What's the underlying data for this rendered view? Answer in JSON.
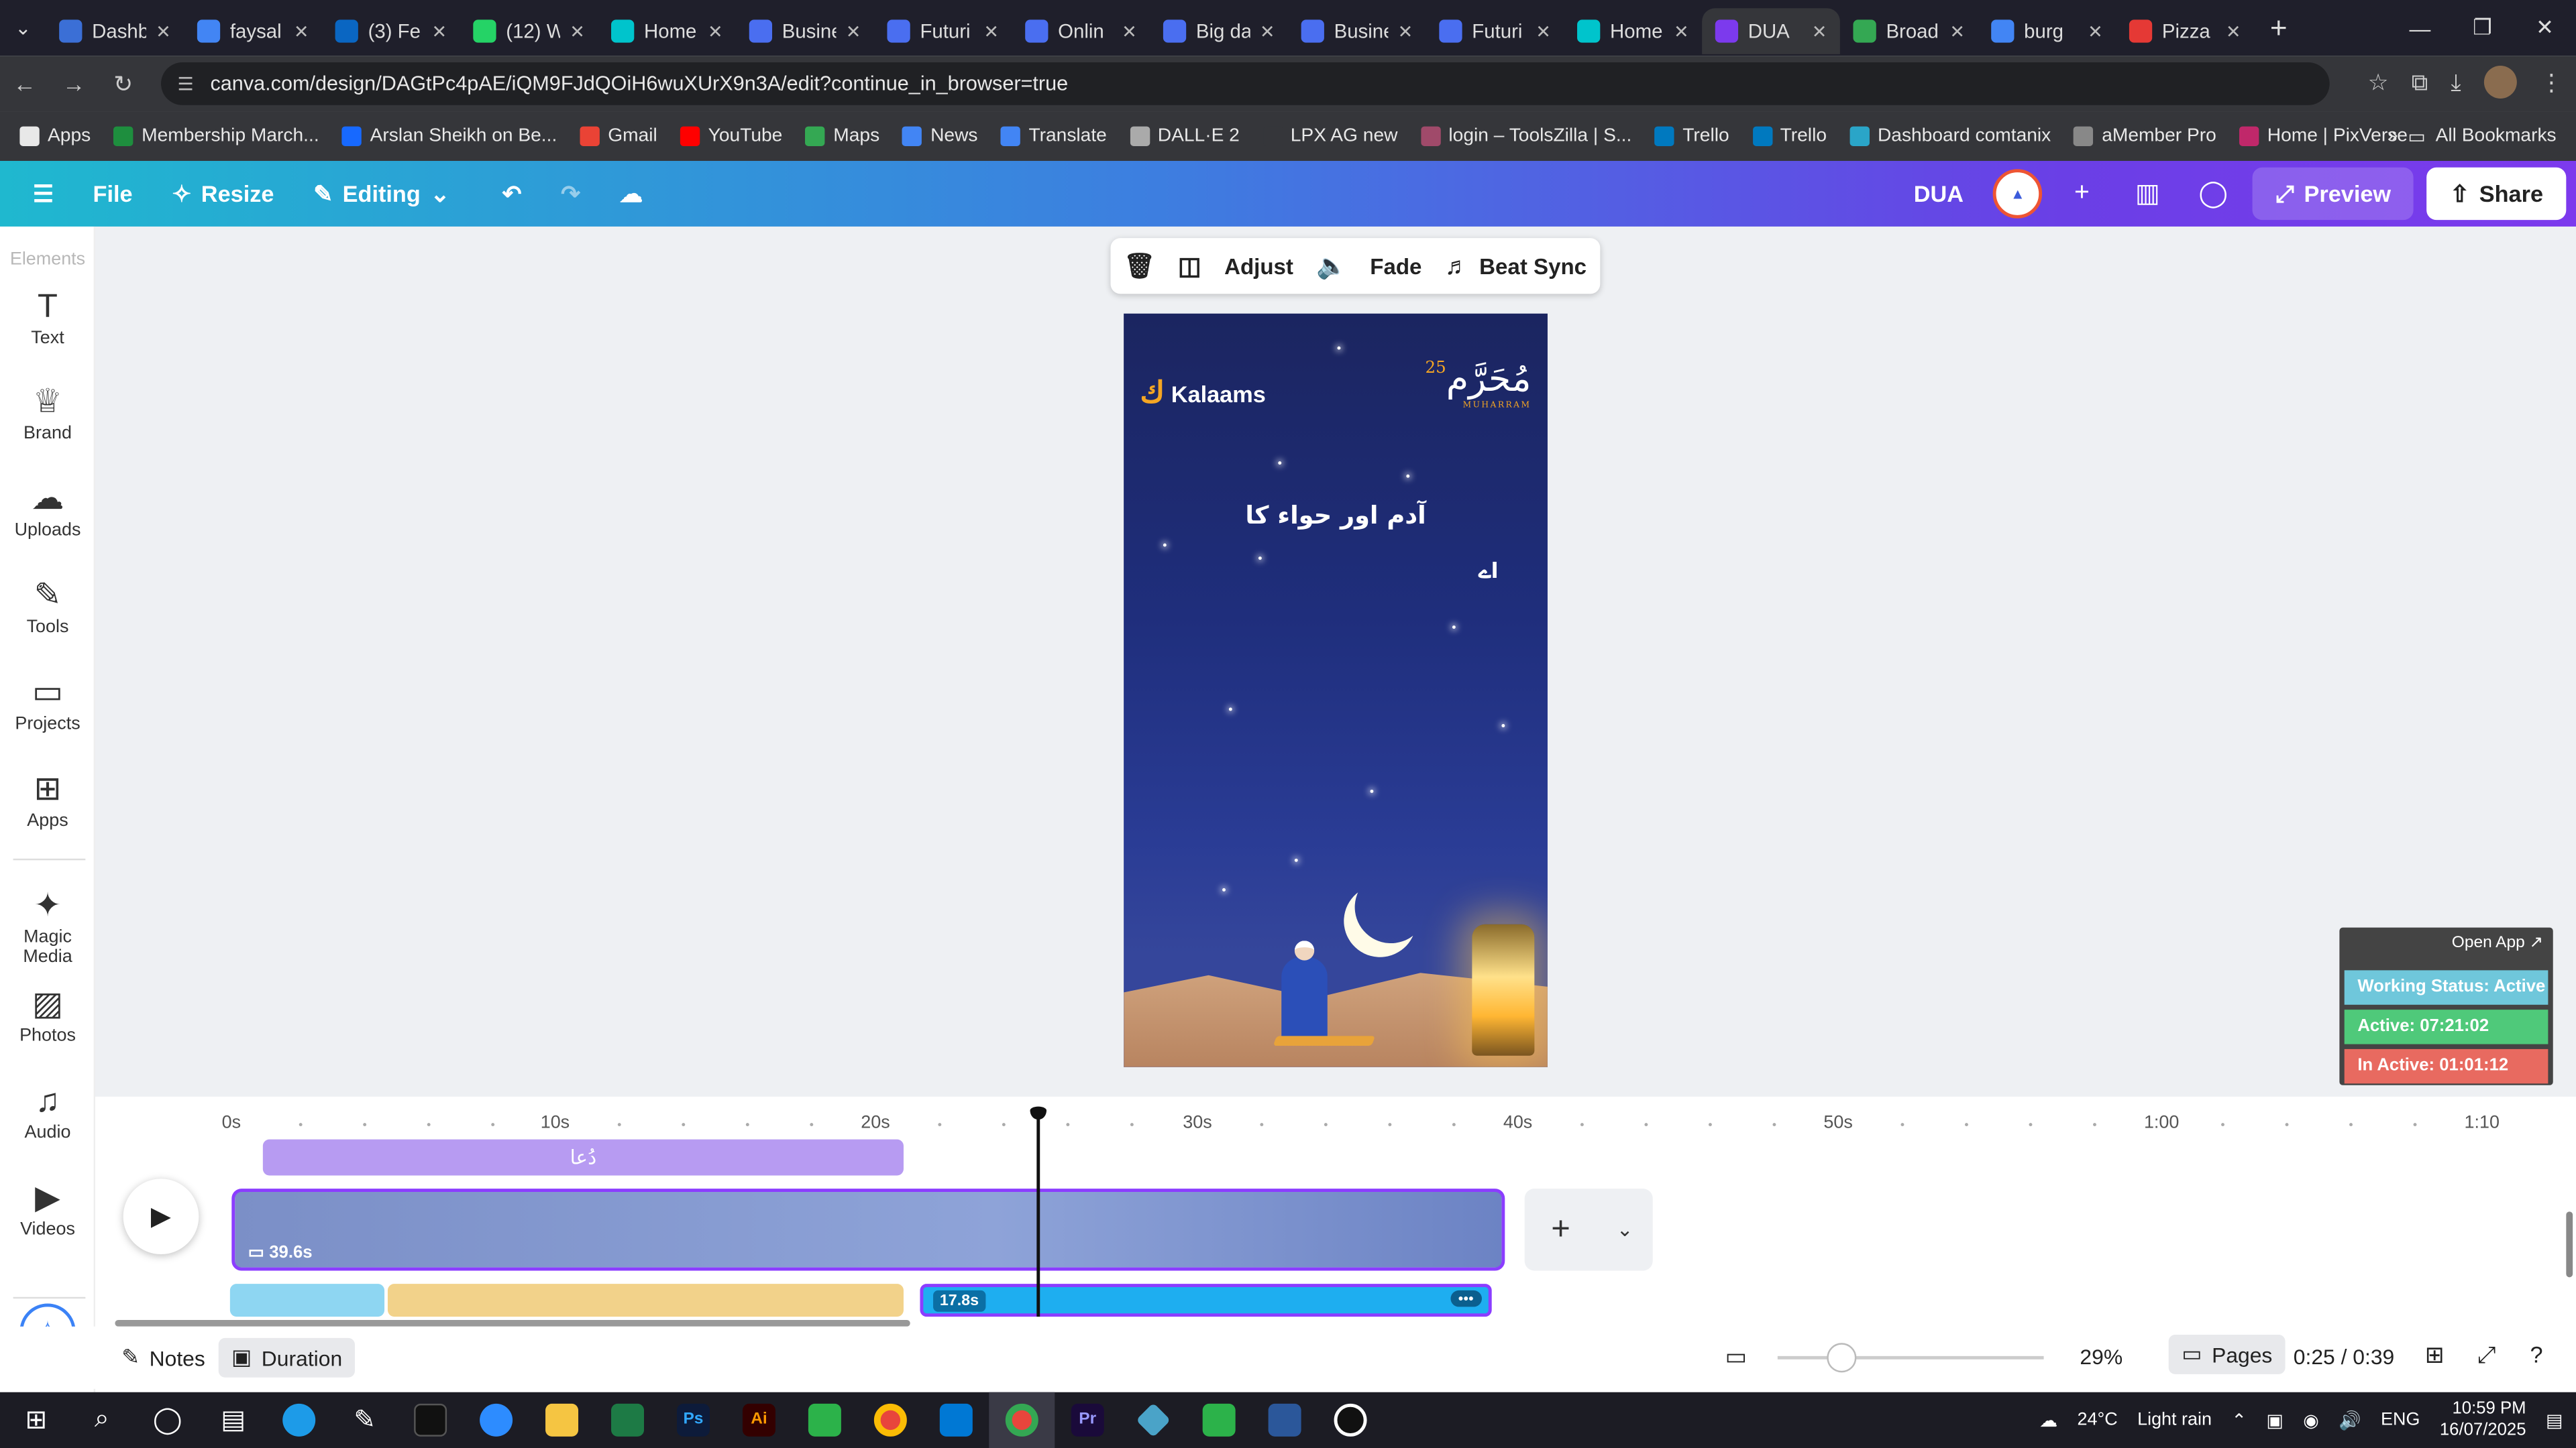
{
  "browser": {
    "tabs": [
      {
        "label": "Dashb",
        "color": "#3b6fd6",
        "active": false
      },
      {
        "label": "faysal",
        "color": "#4285f4",
        "active": false
      },
      {
        "label": "(3) Fe",
        "color": "#0a66c2",
        "active": false
      },
      {
        "label": "(12) W",
        "color": "#25d366",
        "active": false
      },
      {
        "label": "Home",
        "color": "#00c4cc",
        "active": false
      },
      {
        "label": "Busine",
        "color": "#4a6ef0",
        "active": false
      },
      {
        "label": "Futuri",
        "color": "#4a6ef0",
        "active": false
      },
      {
        "label": "Onlin",
        "color": "#4a6ef0",
        "active": false
      },
      {
        "label": "Big da",
        "color": "#4a6ef0",
        "active": false
      },
      {
        "label": "Busine",
        "color": "#4a6ef0",
        "active": false
      },
      {
        "label": "Futuri",
        "color": "#4a6ef0",
        "active": false
      },
      {
        "label": "Home",
        "color": "#00c4cc",
        "active": false
      },
      {
        "label": "DUA",
        "color": "#7c3aed",
        "active": true
      },
      {
        "label": "Broad",
        "color": "#34a853",
        "active": false
      },
      {
        "label": "burg",
        "color": "#4285f4",
        "active": false
      },
      {
        "label": "Pizza",
        "color": "#e53935",
        "active": false
      }
    ],
    "url": "canva.com/design/DAGtPc4pAE/iQM9FJdQOiH6wuXUrX9n3A/edit?continue_in_browser=true",
    "bookmarks": [
      {
        "label": "Apps",
        "color": "#e8e8e8"
      },
      {
        "label": "Membership March...",
        "color": "#1e8e3e"
      },
      {
        "label": "Arslan Sheikh on Be...",
        "color": "#1769ff"
      },
      {
        "label": "Gmail",
        "color": "#ea4335"
      },
      {
        "label": "YouTube",
        "color": "#ff0000"
      },
      {
        "label": "Maps",
        "color": "#34a853"
      },
      {
        "label": "News",
        "color": "#4285f4"
      },
      {
        "label": "Translate",
        "color": "#4285f4"
      },
      {
        "label": "DALL·E 2",
        "color": "#aaaaaa"
      },
      {
        "label": "LPX AG new",
        "color": "#35363a"
      },
      {
        "label": "login – ToolsZilla | S...",
        "color": "#a04a6a"
      },
      {
        "label": "Trello",
        "color": "#0079bf"
      },
      {
        "label": "Trello",
        "color": "#0079bf"
      },
      {
        "label": "Dashboard comtanix",
        "color": "#2aa5c8"
      },
      {
        "label": "aMember Pro",
        "color": "#888888"
      },
      {
        "label": "Home | PixVerse",
        "color": "#c0286a"
      }
    ],
    "all_bookmarks": "All Bookmarks"
  },
  "canva": {
    "file": "File",
    "resize": "Resize",
    "editing": "Editing",
    "design_title": "DUA",
    "preview": "Preview",
    "share": "Share",
    "sidebar": [
      {
        "label": "Elements",
        "icon": "elements-icon",
        "glyph": ""
      },
      {
        "label": "Text",
        "icon": "text-icon",
        "glyph": "T"
      },
      {
        "label": "Brand",
        "icon": "brand-icon",
        "glyph": "♕"
      },
      {
        "label": "Uploads",
        "icon": "uploads-icon",
        "glyph": "☁"
      },
      {
        "label": "Tools",
        "icon": "tools-icon",
        "glyph": "✎"
      },
      {
        "label": "Projects",
        "icon": "projects-icon",
        "glyph": "▭"
      },
      {
        "label": "Apps",
        "icon": "apps-icon",
        "glyph": "⊞"
      },
      {
        "label": "Magic Media",
        "icon": "magic-media-icon",
        "glyph": "✦"
      },
      {
        "label": "Photos",
        "icon": "photos-icon",
        "glyph": "▨"
      },
      {
        "label": "Audio",
        "icon": "audio-icon",
        "glyph": "♫"
      },
      {
        "label": "Videos",
        "icon": "videos-icon",
        "glyph": "▶"
      }
    ],
    "toolbar": {
      "adjust": "Adjust",
      "fade": "Fade",
      "beat_sync": "Beat Sync"
    },
    "design": {
      "brand": "Kalaams",
      "muharram": "مُحَرَّم",
      "muharram_num": "25",
      "muharram_sub": "MUHARRAM",
      "urdu_line1": "آدم اور حواء کا",
      "urdu_line2": "اے"
    },
    "tracker": {
      "open_app": "Open App ↗",
      "working_status": "Working Status: Active",
      "active": "Active: 07:21:02",
      "inactive": "In Active: 01:01:12",
      "colors": {
        "status": "#6fc7db",
        "active": "#4fc97a",
        "inactive": "#e86a60"
      }
    },
    "timeline": {
      "ruler": [
        "0s",
        "10s",
        "20s",
        "30s",
        "40s",
        "50s",
        "1:00",
        "1:10"
      ],
      "title_track": "دُعا",
      "video_length": "39.6s",
      "audio_length": "17.8s",
      "audio_more": "•••"
    },
    "footer": {
      "notes": "Notes",
      "duration": "Duration",
      "zoom": "29%",
      "zoom_level": 0.24,
      "pages": "Pages",
      "time": "0:25 / 0:39"
    }
  },
  "taskbar": {
    "weather_temp": "24°C",
    "weather_text": "Light rain",
    "lang": "ENG",
    "time": "10:59 PM",
    "date": "16/07/2025"
  }
}
